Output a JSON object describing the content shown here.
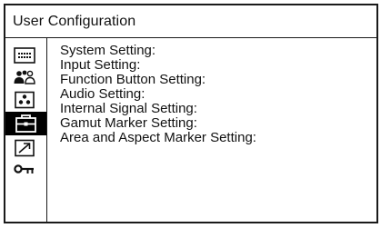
{
  "window": {
    "title": "User Configuration"
  },
  "sidebar": {
    "icons": [
      {
        "name": "display-settings-icon"
      },
      {
        "name": "users-icon"
      },
      {
        "name": "function-button-icon"
      },
      {
        "name": "toolbox-icon",
        "selected": true
      },
      {
        "name": "arrow-up-right-icon"
      },
      {
        "name": "key-icon"
      }
    ]
  },
  "menu": {
    "items": [
      "System Setting:",
      "Input Setting:",
      "Function Button Setting:",
      "Audio Setting:",
      "Internal Signal Setting:",
      "Gamut Marker Setting:",
      "Area and Aspect Marker Setting:"
    ]
  },
  "colors": {
    "border": "#1a1a1a",
    "background": "#ffffff",
    "text": "#111111",
    "selected_bg": "#000000",
    "selected_fg": "#ffffff"
  }
}
